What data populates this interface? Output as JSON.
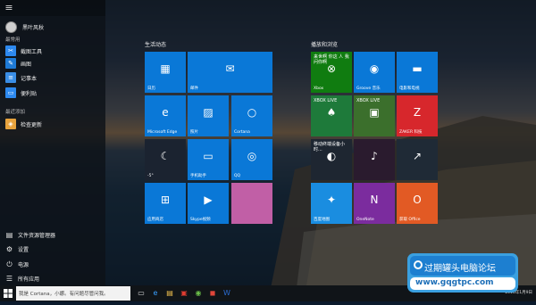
{
  "start_menu": {
    "user": {
      "name": "黑叶风秋"
    },
    "most_used_label": "最常用",
    "apps": [
      {
        "label": "截图工具",
        "icon": "snipping-tool-icon",
        "color": "#2d89ef",
        "glyph": "✂"
      },
      {
        "label": "画图",
        "icon": "paint-icon",
        "color": "#1e7ad6",
        "glyph": "✎"
      },
      {
        "label": "记事本",
        "icon": "notepad-icon",
        "color": "#3a8ee6",
        "glyph": "≡"
      },
      {
        "label": "便利贴",
        "icon": "sticky-notes-icon",
        "color": "#2d89ef",
        "glyph": "▭"
      }
    ],
    "recent_label": "最近添加",
    "recent_apps": [
      {
        "label": "检查更新",
        "icon": "update-icon",
        "color": "#e8a33d",
        "glyph": "◈"
      }
    ],
    "bottom": [
      {
        "label": "文件资源管理器",
        "icon": "file-explorer-icon",
        "glyph": "▤"
      },
      {
        "label": "设置",
        "icon": "gear-icon",
        "glyph": "⚙"
      },
      {
        "label": "电源",
        "icon": "power-icon",
        "glyph": "⏻"
      },
      {
        "label": "所有应用",
        "icon": "all-apps-icon",
        "glyph": "☰"
      }
    ]
  },
  "groups": [
    {
      "title": "生活动态"
    },
    {
      "title": "播放和浏览"
    }
  ],
  "tiles_left": [
    {
      "label": "日历",
      "icon": "calendar-icon",
      "glyph": "▦",
      "color": "#0a78d7"
    },
    {
      "label": "邮件",
      "icon": "mail-icon",
      "glyph": "✉",
      "color": "#0a78d7"
    },
    {
      "label": "Microsoft Edge",
      "icon": "edge-icon",
      "glyph": "e",
      "color": "#0a78d7"
    },
    {
      "label": "照片",
      "icon": "photos-icon",
      "glyph": "▨",
      "color": "#0a78d7"
    },
    {
      "label": "Cortana",
      "icon": "cortana-icon",
      "glyph": "○",
      "color": "#0a78d7"
    },
    {
      "label": "-5°",
      "icon": "weather-icon",
      "glyph": "☾",
      "color": "#1b2330"
    },
    {
      "label": "手机助手",
      "icon": "phone-companion-icon",
      "glyph": "▭",
      "color": "#0a78d7"
    },
    {
      "label": "QQ",
      "icon": "qq-icon",
      "glyph": "◎",
      "color": "#0a78d7"
    },
    {
      "label": "应用商店",
      "icon": "store-icon",
      "glyph": "⊞",
      "color": "#0a78d7"
    },
    {
      "label": "Skype视频",
      "icon": "skype-video-icon",
      "glyph": "▶",
      "color": "#0a78d7"
    },
    {
      "label": "",
      "icon": "game-tile-icon",
      "glyph": "",
      "color": "#c15fa6"
    }
  ],
  "tiles_right": [
    {
      "label": "Xbox",
      "icon": "xbox-icon",
      "glyph": "⊗",
      "color": "#107c10",
      "small": "来世啊 你这\n人 我问你啊"
    },
    {
      "label": "Groove 音乐",
      "icon": "groove-music-icon",
      "glyph": "◉",
      "color": "#0a78d7"
    },
    {
      "label": "电影和电视",
      "icon": "movies-tv-icon",
      "glyph": "▬",
      "color": "#0a78d7"
    },
    {
      "label": "",
      "icon": "solitaire-icon",
      "glyph": "♠",
      "color": "#1e7a3a",
      "small": "XBOX LIVE"
    },
    {
      "label": "",
      "icon": "minecraft-icon",
      "glyph": "▣",
      "color": "#3b6f2c",
      "small": "XBOX LIVE"
    },
    {
      "label": "ZAKER 科技",
      "icon": "zaker-icon",
      "glyph": "Z",
      "color": "#d7272c"
    },
    {
      "label": "",
      "icon": "news-icon",
      "glyph": "◐",
      "color": "#1e2631",
      "small": "移动终端设备小时..."
    },
    {
      "label": "",
      "icon": "music-video-icon",
      "glyph": "♪",
      "color": "#2a1b2e"
    },
    {
      "label": "",
      "icon": "money-icon",
      "glyph": "↗",
      "color": "#1f2a36"
    },
    {
      "label": "百度地图",
      "icon": "baidu-map-icon",
      "glyph": "✦",
      "color": "#1a8de0"
    },
    {
      "label": "OneNote",
      "icon": "onenote-icon",
      "glyph": "N",
      "color": "#7b2c9e"
    },
    {
      "label": "获取 Office",
      "icon": "office-icon",
      "glyph": "O",
      "color": "#e25a24"
    }
  ],
  "taskbar": {
    "search_placeholder": "我是 Cortana，小娜。有问题尽管问我。",
    "icons": [
      {
        "icon": "task-view-icon",
        "glyph": "▭",
        "color": "#dddddd"
      },
      {
        "icon": "edge-taskbar-icon",
        "glyph": "e",
        "color": "#3aa0ff"
      },
      {
        "icon": "file-explorer-taskbar-icon",
        "glyph": "▤",
        "color": "#f2c14e"
      },
      {
        "icon": "app-red-icon",
        "glyph": "▣",
        "color": "#e03c31"
      },
      {
        "icon": "app-green-icon",
        "glyph": "◉",
        "color": "#6cc04a"
      },
      {
        "icon": "app-red2-icon",
        "glyph": "◼",
        "color": "#e0463a"
      },
      {
        "icon": "word-icon",
        "glyph": "W",
        "color": "#2b6cd4"
      }
    ],
    "tray_text": "2016年1月9日"
  },
  "watermark": {
    "title": "过期罐头电脑论坛",
    "url": "www.gqgtpc.com"
  }
}
